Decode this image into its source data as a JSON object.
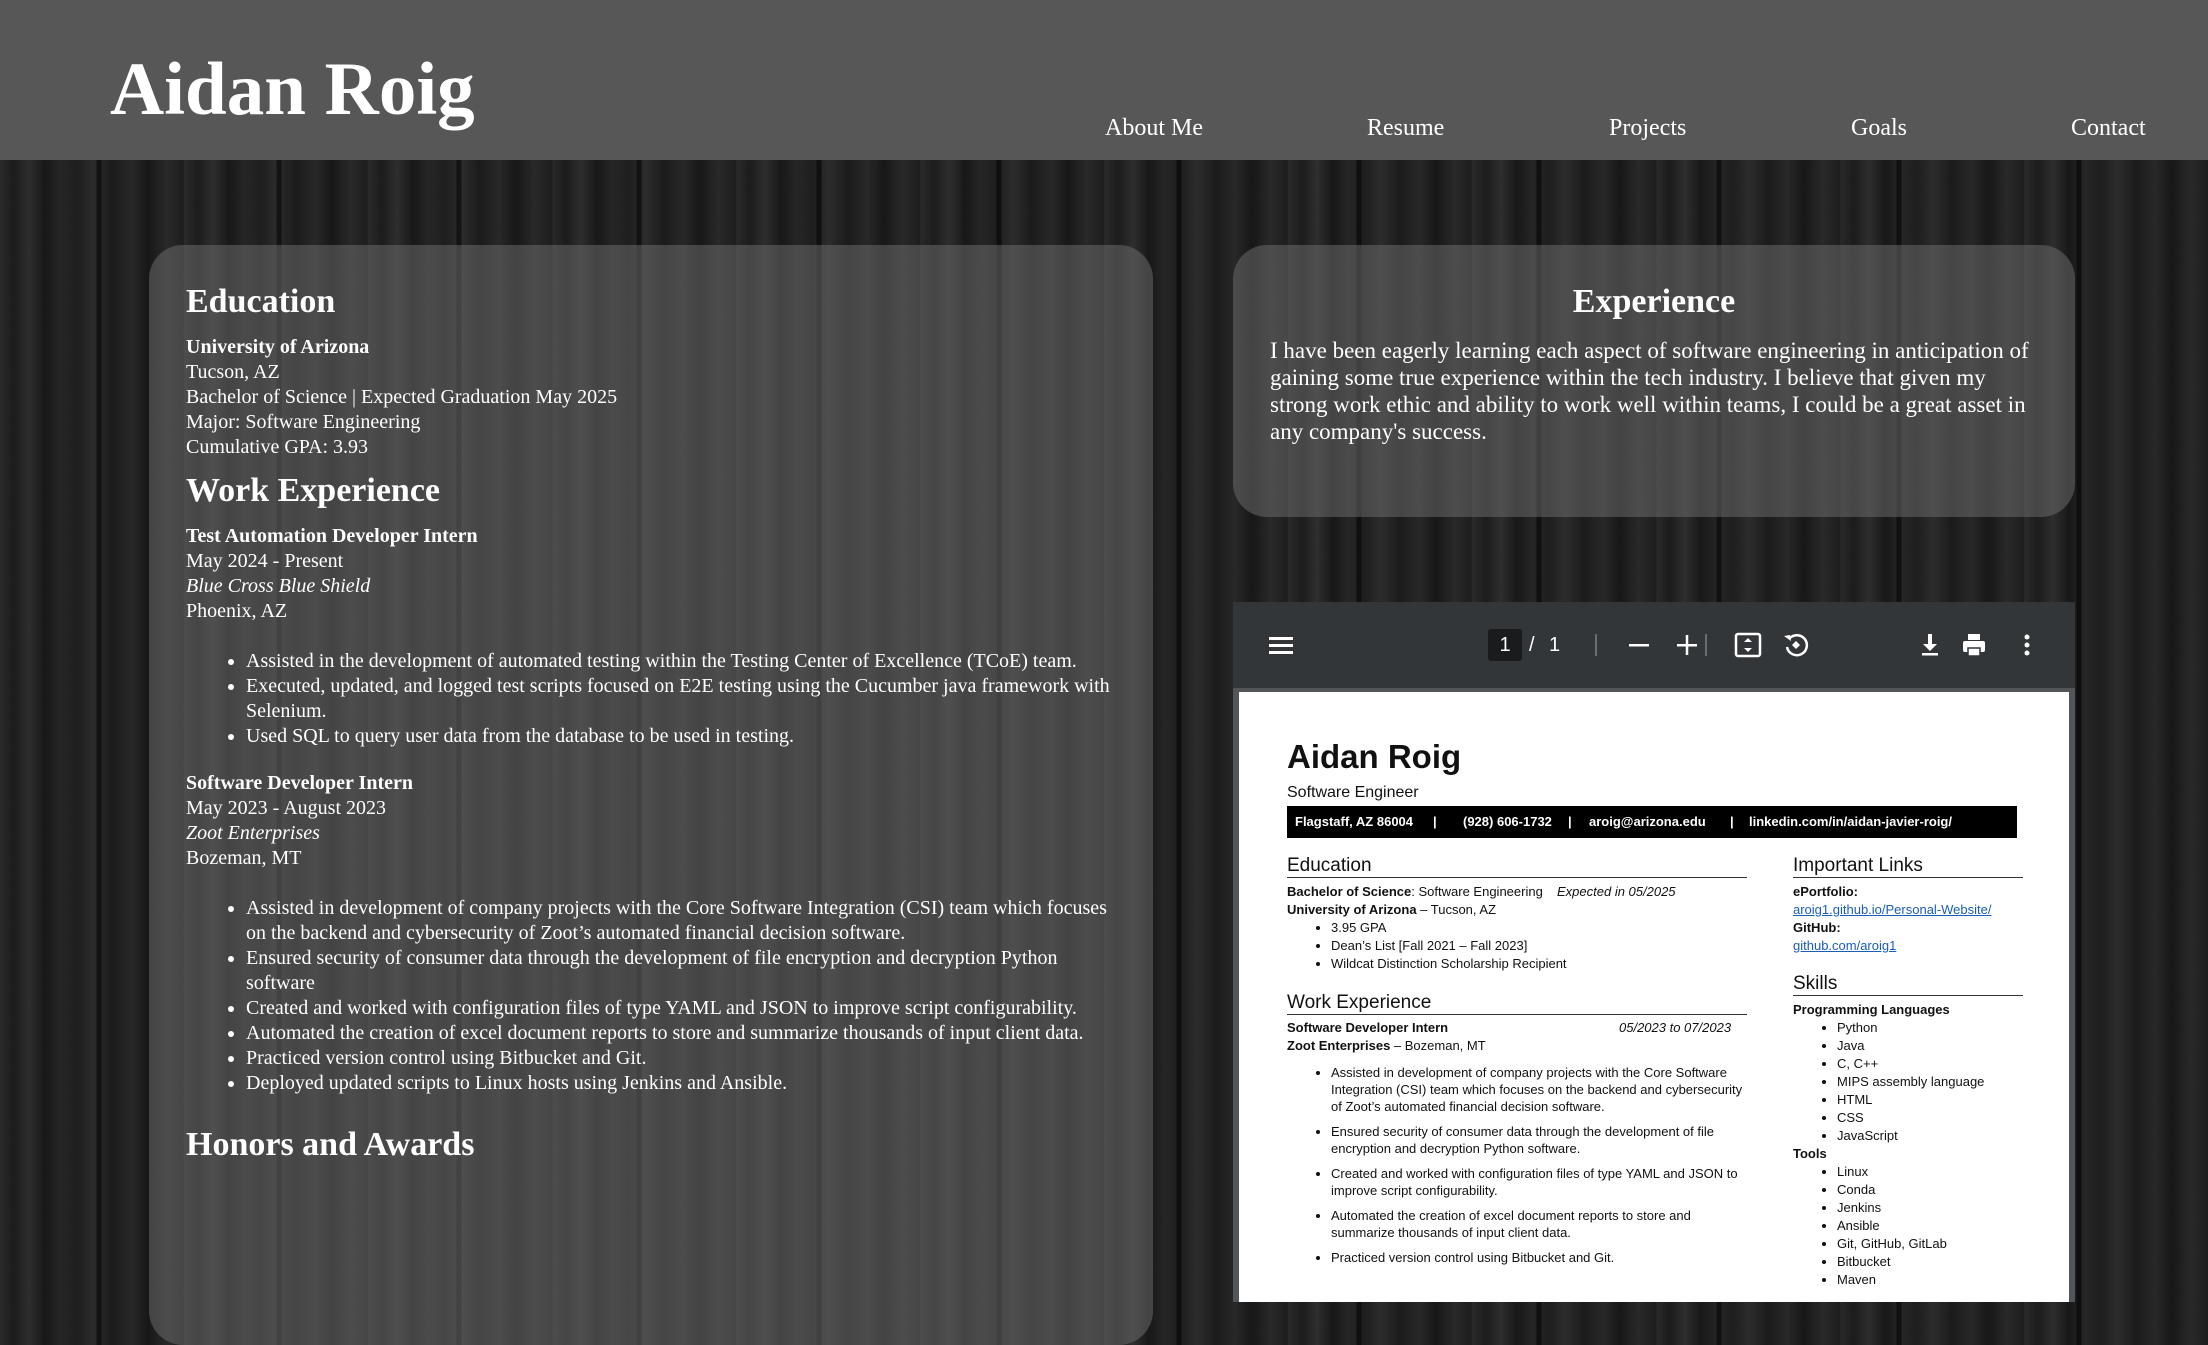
{
  "header": {
    "title": "Aidan Roig",
    "nav": [
      "About Me",
      "Resume",
      "Projects",
      "Goals",
      "Contact"
    ]
  },
  "left": {
    "education": {
      "heading": "Education",
      "school": "University of Arizona",
      "lines": [
        "Tucson, AZ",
        "Bachelor of Science | Expected Graduation May 2025",
        "Major: Software Engineering",
        "Cumulative GPA: 3.93"
      ]
    },
    "work": {
      "heading": "Work Experience",
      "jobs": [
        {
          "title": "Test Automation Developer Intern",
          "dates": "May 2024 - Present",
          "company": "Blue Cross Blue Shield",
          "location": "Phoenix, AZ",
          "bullets": [
            "Assisted in the development of automated testing within the Testing Center of Excellence (TCoE) team.",
            "Executed, updated, and logged test scripts focused on E2E testing using the Cucumber java framework with Selenium.",
            "Used SQL to query user data from the database to be used in testing."
          ]
        },
        {
          "title": "Software Developer Intern",
          "dates": "May 2023 - August 2023",
          "company": "Zoot Enterprises",
          "location": "Bozeman, MT",
          "bullets": [
            "Assisted in development of company projects with the Core Software Integration (CSI) team which focuses on the backend and cybersecurity of Zoot’s automated financial decision software.",
            "Ensured security of consumer data through the development of file encryption and decryption Python software",
            "Created and worked with configuration files of type YAML and JSON to improve script configurability.",
            "Automated the creation of excel document reports to store and summarize thousands of input client data.",
            "Practiced version control using Bitbucket and Git.",
            "Deployed updated scripts to Linux hosts using Jenkins and Ansible."
          ]
        }
      ]
    },
    "honors": {
      "heading": "Honors and Awards"
    }
  },
  "right": {
    "heading": "Experience",
    "text": "I have been eagerly learning each aspect of software engineering in anticipation of gaining some true experience within the tech industry. I believe that given my strong work ethic and ability to work well within teams, I could be a great asset in any company's success."
  },
  "pdf": {
    "page_current": "1",
    "page_sep": "/",
    "page_total": "1",
    "icons": [
      "menu-icon",
      "zoom-out-icon",
      "zoom-in-icon",
      "fit-page-icon",
      "rotate-icon",
      "download-icon",
      "print-icon",
      "more-icon"
    ],
    "doc": {
      "name": "Aidan Roig",
      "subtitle": "Software Engineer",
      "contact": [
        "Flagstaff, AZ 86004",
        "|",
        "(928) 606-1732",
        "|",
        "aroig@arizona.edu",
        "|",
        "linkedin.com/in/aidan-javier-roig/"
      ],
      "education_heading": "Education",
      "degree_label": "Bachelor of Science",
      "degree_rest": ": Software Engineering",
      "degree_date": "Expected in 05/2025",
      "school_label": "University of Arizona",
      "school_rest": " – Tucson, AZ",
      "edu_bullets": [
        "3.95 GPA",
        "Dean’s List [Fall 2021 – Fall 2023]",
        "Wildcat Distinction Scholarship Recipient"
      ],
      "work_heading": "Work Experience",
      "job_title": "Software Developer Intern",
      "job_dates": "05/2023 to 07/2023",
      "job_company": "Zoot Enterprises",
      "job_location": " – Bozeman, MT",
      "job_bullets": [
        "Assisted in development of company projects with the Core Software Integration (CSI) team which focuses on the backend and cybersecurity of Zoot’s automated financial decision software.",
        "Ensured security of consumer data through the development of file encryption and decryption Python software.",
        "Created and worked with configuration files of type YAML and JSON to improve script configurability.",
        "Automated the creation of excel document reports to store and summarize thousands of input client data.",
        "Practiced version control using Bitbucket and Git."
      ],
      "links_heading": "Important Links",
      "eportfolio_label": "ePortfolio:",
      "eportfolio_url": "aroig1.github.io/Personal-Website/",
      "github_label": "GitHub:",
      "github_url": "github.com/aroig1",
      "skills_heading": "Skills",
      "lang_label": "Programming Languages",
      "languages": [
        "Python",
        "Java",
        "C, C++",
        "MIPS assembly language",
        "HTML",
        "CSS",
        "JavaScript"
      ],
      "tools_label": "Tools",
      "tools": [
        "Linux",
        "Conda",
        "Jenkins",
        "Ansible",
        "Git, GitHub, GitLab",
        "Bitbucket",
        "Maven"
      ]
    }
  }
}
